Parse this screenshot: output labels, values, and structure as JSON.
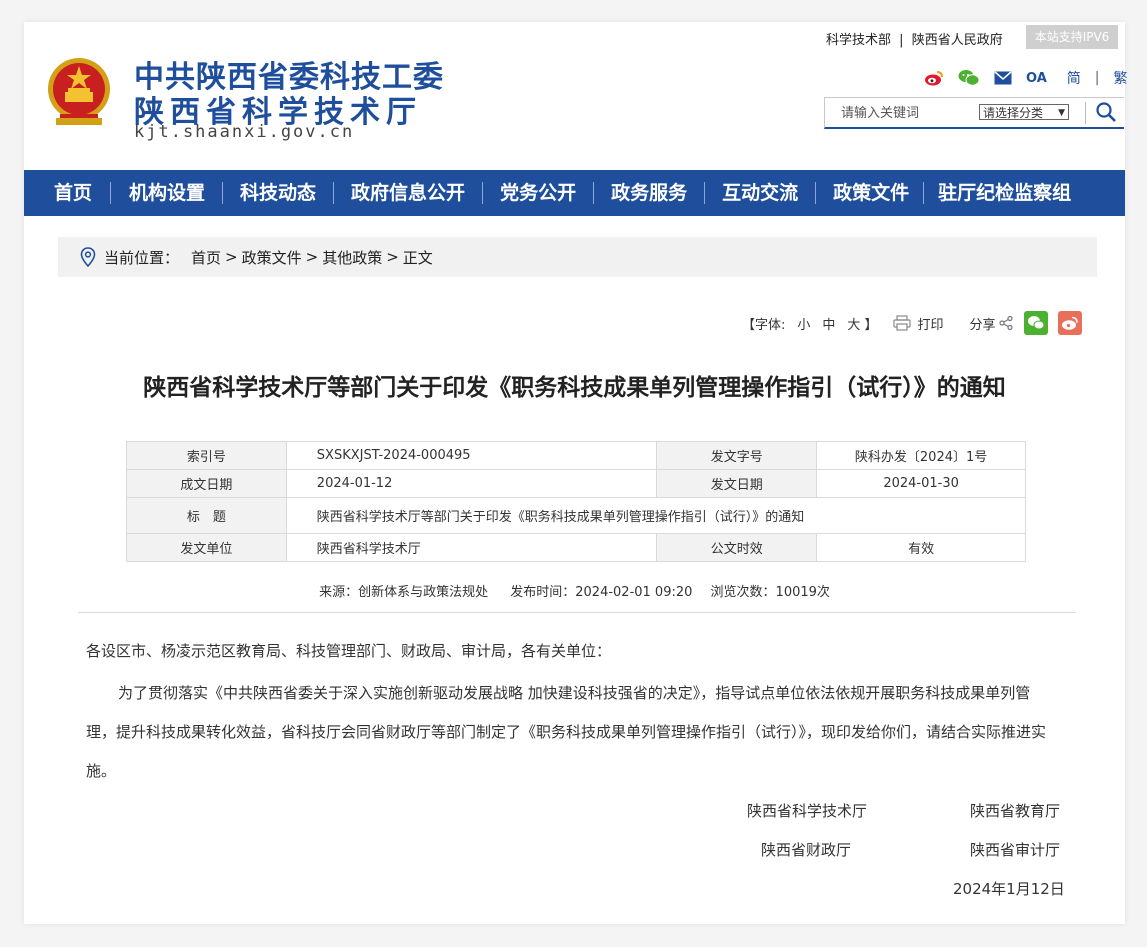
{
  "header": {
    "title_line1": "中共陕西省委科技工委",
    "title_line2": "陕西省科学技术厅",
    "url": "kjt.shaanxi.gov.cn",
    "top_link_1": "科学技术部",
    "top_link_sep": "|",
    "top_link_2": "陕西省人民政府",
    "ipv6_badge": "本站支持IPV6",
    "oa_label": "OA",
    "lang_simplified": "简",
    "lang_sep": "|",
    "lang_traditional": "繁",
    "search_placeholder": "请输入关键词",
    "search_category": "请选择分类"
  },
  "nav": {
    "items": [
      "首页",
      "机构设置",
      "科技动态",
      "政府信息公开",
      "党务公开",
      "政务服务",
      "互动交流",
      "政策文件",
      "驻厅纪检监察组"
    ]
  },
  "breadcrumb": {
    "label": "当前位置：",
    "items": [
      "首页",
      "政策文件",
      "其他政策",
      "正文"
    ],
    "sep": ">"
  },
  "tools": {
    "font_open": "【字体:",
    "font_small": "小",
    "font_medium": "中",
    "font_large": "大",
    "font_close": "】",
    "print": "打印",
    "share": "分享"
  },
  "article": {
    "title": "陕西省科学技术厅等部门关于印发《职务科技成果单列管理操作指引（试行）》的通知",
    "meta": {
      "index_label": "索引号",
      "index_value": "SXSKXJST-2024-000495",
      "docno_label": "发文字号",
      "docno_value": "陕科办发〔2024〕1号",
      "created_label": "成文日期",
      "created_value": "2024-01-12",
      "issued_label": "发文日期",
      "issued_value": "2024-01-30",
      "title_label": "标　题",
      "title_value": "陕西省科学技术厅等部门关于印发《职务科技成果单列管理操作指引（试行）》的通知",
      "issuer_label": "发文单位",
      "issuer_value": "陕西省科学技术厅",
      "validity_label": "公文时效",
      "validity_value": "有效"
    },
    "source": "来源：创新体系与政策法规处",
    "publish_time": "发布时间：2024-02-01 09:20",
    "views": "浏览次数：10019次",
    "salutation": "各设区市、杨凌示范区教育局、科技管理部门、财政局、审计局，各有关单位：",
    "body_line1": "为了贯彻落实《中共陕西省委关于深入实施创新驱动发展战略 加快建设科技强省的决定》，指导试点单位依法依规开展职务科技成果单列管",
    "body_line2": "理，提升科技成果转化效益，省科技厅会同省财政厅等部门制定了《职务科技成果单列管理操作指引（试行）》，现印发给你们，请结合实际推进实",
    "body_line3": "施。",
    "signers": [
      "陕西省科学技术厅",
      "陕西省教育厅",
      "陕西省财政厅",
      "陕西省审计厅"
    ],
    "date": "2024年1月12日"
  }
}
